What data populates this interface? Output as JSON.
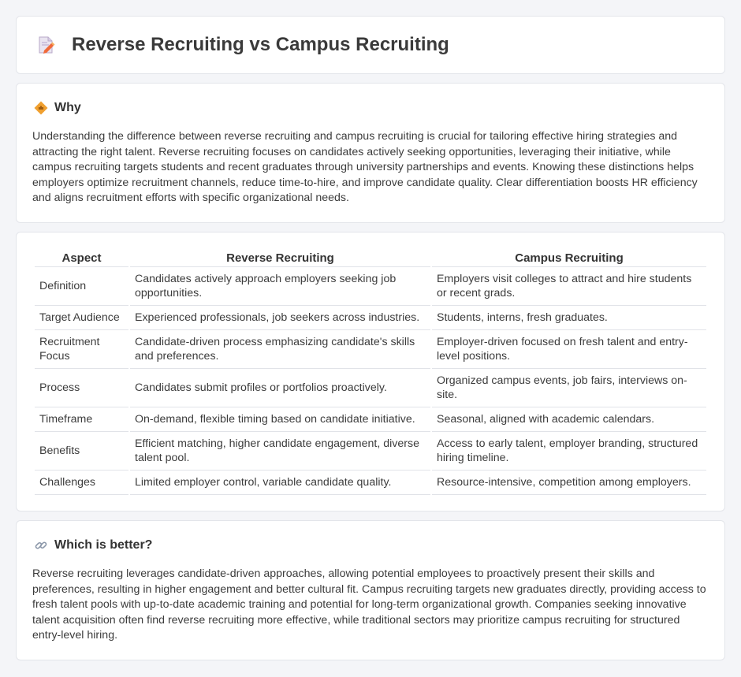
{
  "header": {
    "title": "Reverse Recruiting vs Campus Recruiting",
    "icon": "document-pen-icon"
  },
  "why": {
    "heading": "Why",
    "icon": "diamond-signal-icon",
    "body": "Understanding the difference between reverse recruiting and campus recruiting is crucial for tailoring effective hiring strategies and attracting the right talent. Reverse recruiting focuses on candidates actively seeking opportunities, leveraging their initiative, while campus recruiting targets students and recent graduates through university partnerships and events. Knowing these distinctions helps employers optimize recruitment channels, reduce time-to-hire, and improve candidate quality. Clear differentiation boosts HR efficiency and aligns recruitment efforts with specific organizational needs."
  },
  "comparison": {
    "headers": [
      "Aspect",
      "Reverse Recruiting",
      "Campus Recruiting"
    ],
    "rows": [
      [
        "Definition",
        "Candidates actively approach employers seeking job opportunities.",
        "Employers visit colleges to attract and hire students or recent grads."
      ],
      [
        "Target Audience",
        "Experienced professionals, job seekers across industries.",
        "Students, interns, fresh graduates."
      ],
      [
        "Recruitment Focus",
        "Candidate-driven process emphasizing candidate's skills and preferences.",
        "Employer-driven focused on fresh talent and entry-level positions."
      ],
      [
        "Process",
        "Candidates submit profiles or portfolios proactively.",
        "Organized campus events, job fairs, interviews on-site."
      ],
      [
        "Timeframe",
        "On-demand, flexible timing based on candidate initiative.",
        "Seasonal, aligned with academic calendars."
      ],
      [
        "Benefits",
        "Efficient matching, higher candidate engagement, diverse talent pool.",
        "Access to early talent, employer branding, structured hiring timeline."
      ],
      [
        "Challenges",
        "Limited employer control, variable candidate quality.",
        "Resource-intensive, competition among employers."
      ]
    ]
  },
  "better": {
    "heading": "Which is better?",
    "icon": "link-icon",
    "body": "Reverse recruiting leverages candidate-driven approaches, allowing potential employees to proactively present their skills and preferences, resulting in higher engagement and better cultural fit. Campus recruiting targets new graduates directly, providing access to fresh talent pools with up-to-date academic training and potential for long-term organizational growth. Companies seeking innovative talent acquisition often find reverse recruiting more effective, while traditional sectors may prioritize campus recruiting for structured entry-level hiring."
  },
  "colors": {
    "accent_orange": "#f0a030",
    "page_bg": "#f4f5f8",
    "card_border": "#e3e5ea"
  }
}
